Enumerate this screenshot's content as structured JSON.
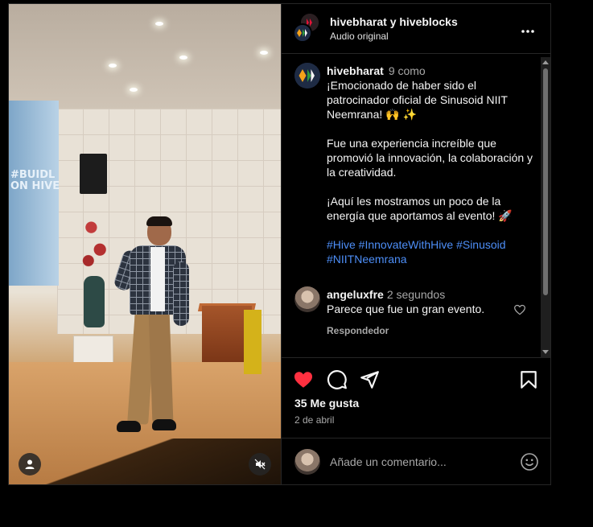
{
  "header": {
    "title": "hivebharat y hiveblocks",
    "subtitle": "Audio original",
    "more_label": "•••"
  },
  "photo": {
    "screen_text": "#BUIDL\nON HIVE"
  },
  "caption": {
    "username": "hivebharat",
    "time": "9 como",
    "line1": "¡Emocionado de haber sido el patrocinador oficial de Sinusoid NIIT Neemrana! 🙌 ✨",
    "line2": "Fue una experiencia increíble que promovió la innovación, la colaboración y la creatividad.",
    "line3": "¡Aquí les mostramos un poco de la energía que aportamos al evento! 🚀",
    "hashtags": "#Hive #InnovateWithHive #Sinusoid #NIITNeemrana"
  },
  "comment": {
    "username": "angeluxfre",
    "time": "2 segundos",
    "text": "Parece que fue un gran evento.",
    "reply_label": "Respondedor"
  },
  "actions": {
    "likes": "35 Me gusta",
    "date": "2 de abril",
    "like_color": "#ff3040"
  },
  "add_comment": {
    "placeholder": "Añade un comentario..."
  },
  "colors": {
    "background": "#000000",
    "text": "#f5f5f5",
    "muted": "#a8a8a8",
    "link": "#4d8ef7"
  }
}
